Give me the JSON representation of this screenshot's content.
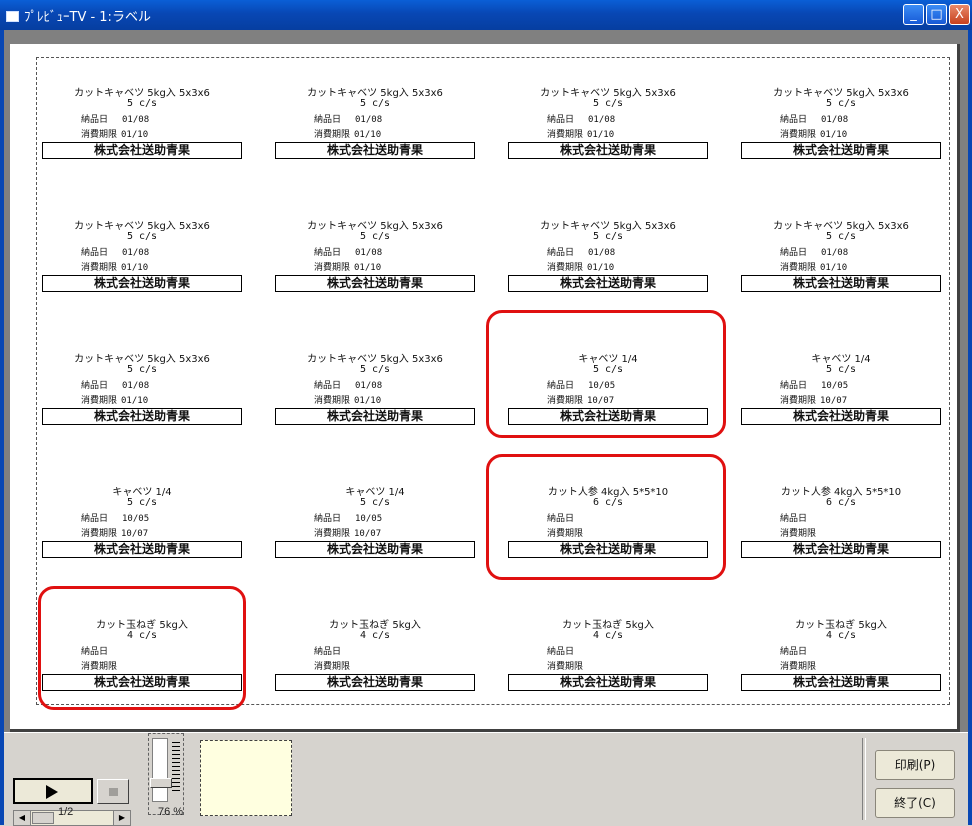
{
  "window": {
    "title": "ﾌﾟﾚﾋﾞｭｰTV - 1:ラベル",
    "minimize": "_",
    "maximize": "□",
    "close": "X"
  },
  "company": "株式会社送助青果",
  "labels": [
    {
      "product": "カットキャベツ 5kg入 5x3x6",
      "cases": "5 c/s",
      "delivery_label": "納品日",
      "delivery": "01/08",
      "expiry_label": "消費期限",
      "expiry": "01/10"
    },
    {
      "product": "カットキャベツ 5kg入 5x3x6",
      "cases": "5 c/s",
      "delivery_label": "納品日",
      "delivery": "01/08",
      "expiry_label": "消費期限",
      "expiry": "01/10"
    },
    {
      "product": "カットキャベツ 5kg入 5x3x6",
      "cases": "5 c/s",
      "delivery_label": "納品日",
      "delivery": "01/08",
      "expiry_label": "消費期限",
      "expiry": "01/10"
    },
    {
      "product": "カットキャベツ 5kg入 5x3x6",
      "cases": "5 c/s",
      "delivery_label": "納品日",
      "delivery": "01/08",
      "expiry_label": "消費期限",
      "expiry": "01/10"
    },
    {
      "product": "カットキャベツ 5kg入 5x3x6",
      "cases": "5 c/s",
      "delivery_label": "納品日",
      "delivery": "01/08",
      "expiry_label": "消費期限",
      "expiry": "01/10"
    },
    {
      "product": "カットキャベツ 5kg入 5x3x6",
      "cases": "5 c/s",
      "delivery_label": "納品日",
      "delivery": "01/08",
      "expiry_label": "消費期限",
      "expiry": "01/10"
    },
    {
      "product": "カットキャベツ 5kg入 5x3x6",
      "cases": "5 c/s",
      "delivery_label": "納品日",
      "delivery": "01/08",
      "expiry_label": "消費期限",
      "expiry": "01/10"
    },
    {
      "product": "カットキャベツ 5kg入 5x3x6",
      "cases": "5 c/s",
      "delivery_label": "納品日",
      "delivery": "01/08",
      "expiry_label": "消費期限",
      "expiry": "01/10"
    },
    {
      "product": "カットキャベツ 5kg入 5x3x6",
      "cases": "5 c/s",
      "delivery_label": "納品日",
      "delivery": "01/08",
      "expiry_label": "消費期限",
      "expiry": "01/10"
    },
    {
      "product": "カットキャベツ 5kg入 5x3x6",
      "cases": "5 c/s",
      "delivery_label": "納品日",
      "delivery": "01/08",
      "expiry_label": "消費期限",
      "expiry": "01/10"
    },
    {
      "product": "キャベツ 1/4",
      "cases": "5 c/s",
      "delivery_label": "納品日",
      "delivery": "10/05",
      "expiry_label": "消費期限",
      "expiry": "10/07"
    },
    {
      "product": "キャベツ 1/4",
      "cases": "5 c/s",
      "delivery_label": "納品日",
      "delivery": "10/05",
      "expiry_label": "消費期限",
      "expiry": "10/07"
    },
    {
      "product": "キャベツ 1/4",
      "cases": "5 c/s",
      "delivery_label": "納品日",
      "delivery": "10/05",
      "expiry_label": "消費期限",
      "expiry": "10/07"
    },
    {
      "product": "キャベツ 1/4",
      "cases": "5 c/s",
      "delivery_label": "納品日",
      "delivery": "10/05",
      "expiry_label": "消費期限",
      "expiry": "10/07"
    },
    {
      "product": "カット人参 4kg入 5*5*10",
      "cases": "6 c/s",
      "delivery_label": "納品日",
      "delivery": "",
      "expiry_label": "消費期限",
      "expiry": ""
    },
    {
      "product": "カット人参 4kg入 5*5*10",
      "cases": "6 c/s",
      "delivery_label": "納品日",
      "delivery": "",
      "expiry_label": "消費期限",
      "expiry": ""
    },
    {
      "product": "カット玉ねぎ 5kg入",
      "cases": "4 c/s",
      "delivery_label": "納品日",
      "delivery": "",
      "expiry_label": "消費期限",
      "expiry": ""
    },
    {
      "product": "カット玉ねぎ 5kg入",
      "cases": "4 c/s",
      "delivery_label": "納品日",
      "delivery": "",
      "expiry_label": "消費期限",
      "expiry": ""
    },
    {
      "product": "カット玉ねぎ 5kg入",
      "cases": "4 c/s",
      "delivery_label": "納品日",
      "delivery": "",
      "expiry_label": "消費期限",
      "expiry": ""
    },
    {
      "product": "カット玉ねぎ 5kg入",
      "cases": "4 c/s",
      "delivery_label": "納品日",
      "delivery": "",
      "expiry_label": "消費期限",
      "expiry": ""
    }
  ],
  "highlight_color": "#e01010",
  "toolbar": {
    "page_indicator": "1/2",
    "zoom": "76 %",
    "print_button": "印刷(P)",
    "quit_button": "終了(C)",
    "play_icon": "play-icon",
    "stop_icon": "stop-icon"
  }
}
